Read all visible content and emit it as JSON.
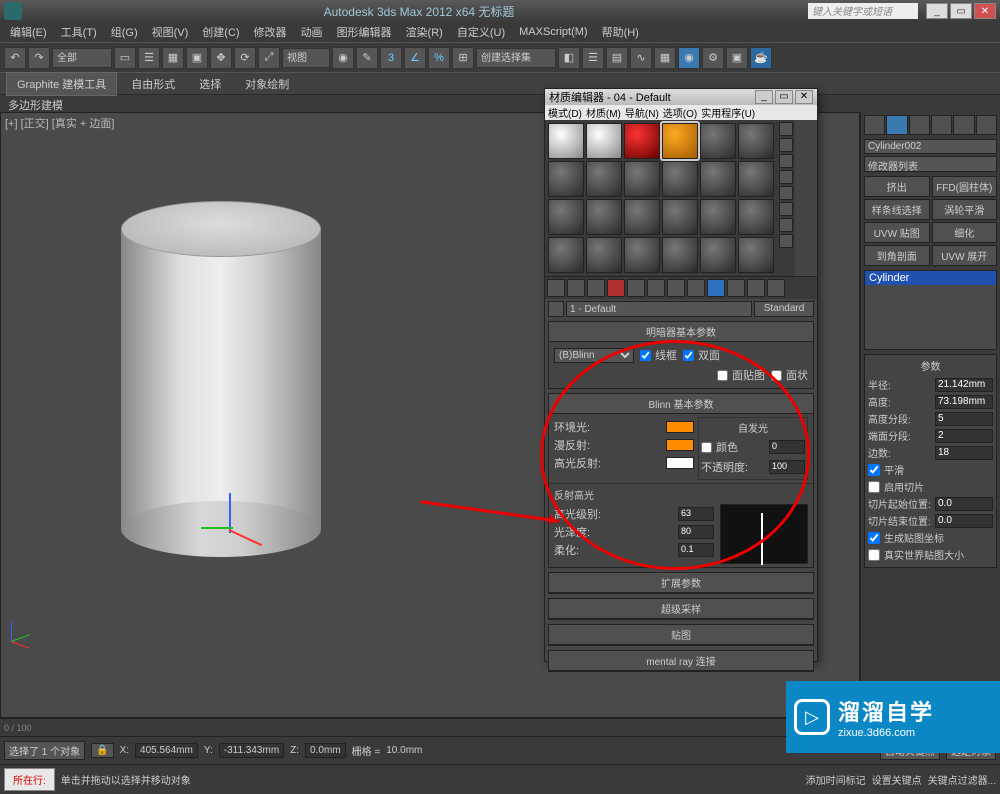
{
  "title": "Autodesk 3ds Max 2012 x64   无标题",
  "search_placeholder": "键入关键字或短语",
  "menus": [
    "编辑(E)",
    "工具(T)",
    "组(G)",
    "视图(V)",
    "创建(C)",
    "修改器",
    "动画",
    "图形编辑器",
    "渲染(R)",
    "自定义(U)",
    "MAXScript(M)",
    "帮助(H)"
  ],
  "toolbar_combo": "全部",
  "toolbar_view": "视图",
  "toolbar_selset": "创建选择集",
  "ribbon": {
    "tabs": [
      "Graphite 建模工具",
      "自由形式",
      "选择",
      "对象绘制"
    ],
    "sub": "多边形建模"
  },
  "viewport_label": "[+] [正交] [真实 + 边面]",
  "sidepanel": {
    "object_name": "Cylinder002",
    "modifier_list": "修改器列表",
    "buttons": [
      "挤出",
      "FFD(圆柱体)",
      "样条线选择",
      "涡轮平滑",
      "UVW 贴图",
      "细化",
      "到角剖面",
      "UVW 展开"
    ],
    "stack_item": "Cylinder",
    "params_title": "参数",
    "radius_label": "半径:",
    "radius_val": "21.142mm",
    "height_label": "高度:",
    "height_val": "73.198mm",
    "hseg_label": "高度分段:",
    "hseg_val": "5",
    "cseg_label": "端面分段:",
    "cseg_val": "2",
    "sides_label": "边数:",
    "sides_val": "18",
    "smooth": "平滑",
    "sliceon": "启用切片",
    "slice_from_label": "切片起始位置:",
    "slice_from_val": "0.0",
    "slice_to_label": "切片结束位置:",
    "slice_to_val": "0.0",
    "genmap": "生成贴图坐标",
    "realworld": "真实世界贴图大小"
  },
  "material": {
    "title": "材质编辑器 - 04 - Default",
    "menus": [
      "模式(D)",
      "材质(M)",
      "导航(N)",
      "选项(O)",
      "实用程序(U)"
    ],
    "name": "1 - Default",
    "type": "Standard",
    "shader_roll": "明暗器基本参数",
    "shader": "(B)Blinn",
    "wire": "线框",
    "twoside": "双面",
    "facemap": "面贴图",
    "faceted": "面状",
    "blinn_roll": "Blinn 基本参数",
    "selfillum_grp": "自发光",
    "ambient": "环境光:",
    "diffuse": "漫反射:",
    "specular": "高光反射:",
    "color_chk": "颜色",
    "selfillum_val": "0",
    "opacity": "不透明度:",
    "opacity_val": "100",
    "spec_hi": "反射高光",
    "spec_level": "高光级别:",
    "spec_level_val": "63",
    "gloss": "光泽度:",
    "gloss_val": "80",
    "soften": "柔化:",
    "soften_val": "0.1",
    "rolls": [
      "扩展参数",
      "超级采样",
      "贴图",
      "mental ray 连接"
    ]
  },
  "timeline": "0 / 100",
  "status": {
    "sel": "选择了 1 个对象",
    "x_label": "X:",
    "x": "405.564mm",
    "y_label": "Y:",
    "y": "-311.343mm",
    "z_label": "Z:",
    "z": "0.0mm",
    "grid_label": "栅格 =",
    "grid": "10.0mm",
    "autokey": "自动关键点",
    "selbtn": "选定对象",
    "setkey": "设置关键点",
    "keyfilter": "关键点过滤器..."
  },
  "prompt": {
    "now": "所在行:",
    "addtime": "添加时间标记",
    "hint": "单击并拖动以选择并移动对象"
  },
  "watermark": {
    "big": "溜溜自学",
    "small": "zixue.3d66.com"
  }
}
